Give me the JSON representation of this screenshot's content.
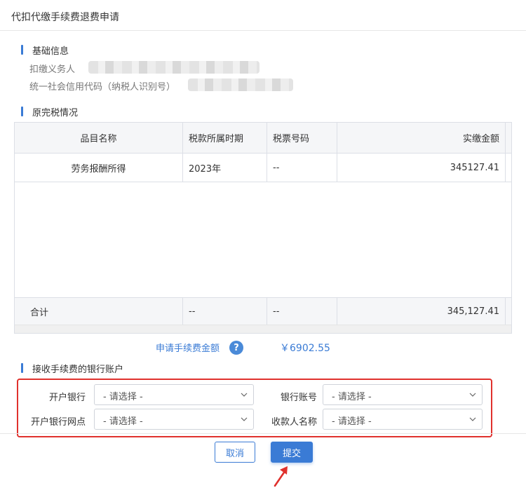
{
  "window": {
    "title": "代扣代缴手续费退费申请"
  },
  "basic_info": {
    "heading": "基础信息",
    "withholder_label": "扣缴义务人",
    "credit_code_label": "统一社会信用代码（纳税人识别号）"
  },
  "tax_section": {
    "heading": "原完税情况"
  },
  "table": {
    "headers": [
      "品目名称",
      "税款所属时期",
      "税票号码",
      "实缴金额"
    ],
    "rows": [
      [
        "劳务报酬所得",
        "2023年",
        "--",
        "345127.41"
      ]
    ],
    "total": [
      "合计",
      "--",
      "--",
      "345,127.41"
    ]
  },
  "fee": {
    "label": "申请手续费金额",
    "help_symbol": "?",
    "value": "￥6902.55"
  },
  "bank_section": {
    "heading": "接收手续费的银行账户",
    "fields": [
      {
        "label": "开户银行",
        "value": "- 请选择 -"
      },
      {
        "label": "银行账号",
        "value": "- 请选择 -"
      },
      {
        "label": "开户银行网点",
        "value": "- 请选择 -"
      },
      {
        "label": "收款人名称",
        "value": "- 请选择 -"
      }
    ]
  },
  "buttons": {
    "cancel": "取消",
    "submit": "提交"
  },
  "colors": {
    "accent": "#3a7bd5",
    "highlight": "#e0312d"
  }
}
